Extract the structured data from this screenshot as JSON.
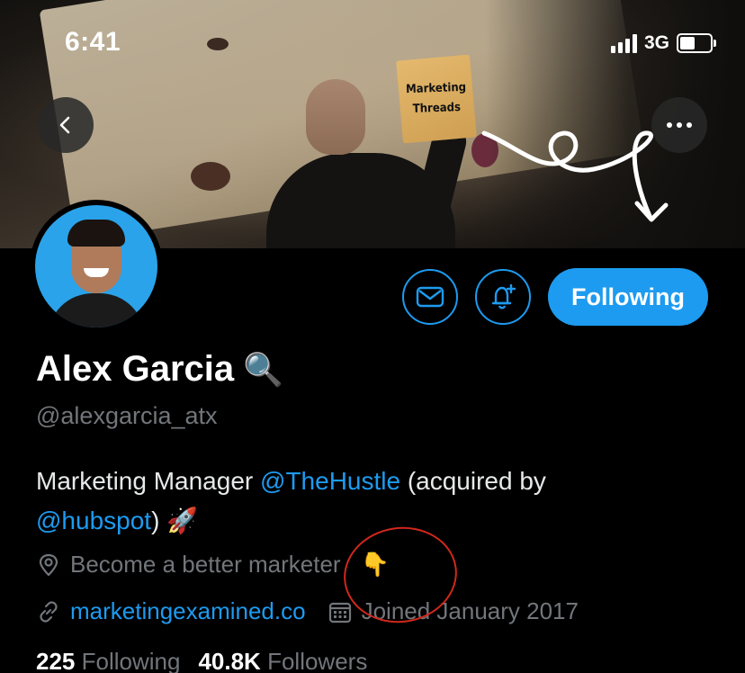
{
  "status_bar": {
    "time": "6:41",
    "network": "3G"
  },
  "banner": {
    "envelope_line1": "Marketing",
    "envelope_line2": "Threads"
  },
  "nav": {
    "back_icon": "chevron-left-icon",
    "more_icon": "more-horizontal-icon"
  },
  "actions": {
    "message_icon": "envelope-icon",
    "notify_icon": "bell-plus-icon",
    "follow_label": "Following"
  },
  "profile": {
    "name": "Alex Garcia",
    "name_emoji": "🔍",
    "handle": "@alexgarcia_atx",
    "bio_part1": "Marketing Manager ",
    "bio_mention1": "@TheHustle",
    "bio_part2": " (acquired by ",
    "bio_mention2": "@hubspot",
    "bio_part3": ") ",
    "bio_emoji": "🚀",
    "location": "Become a better marketer",
    "location_emoji": "👇",
    "website": "marketingexamined.co",
    "joined": "Joined January 2017"
  },
  "stats": {
    "following_count": "225",
    "following_label": "Following",
    "followers_count": "40.8K",
    "followers_label": "Followers"
  },
  "colors": {
    "accent": "#1d9bf0",
    "background": "#000000",
    "muted_text": "#72767b",
    "annotation": "#d0281c"
  }
}
